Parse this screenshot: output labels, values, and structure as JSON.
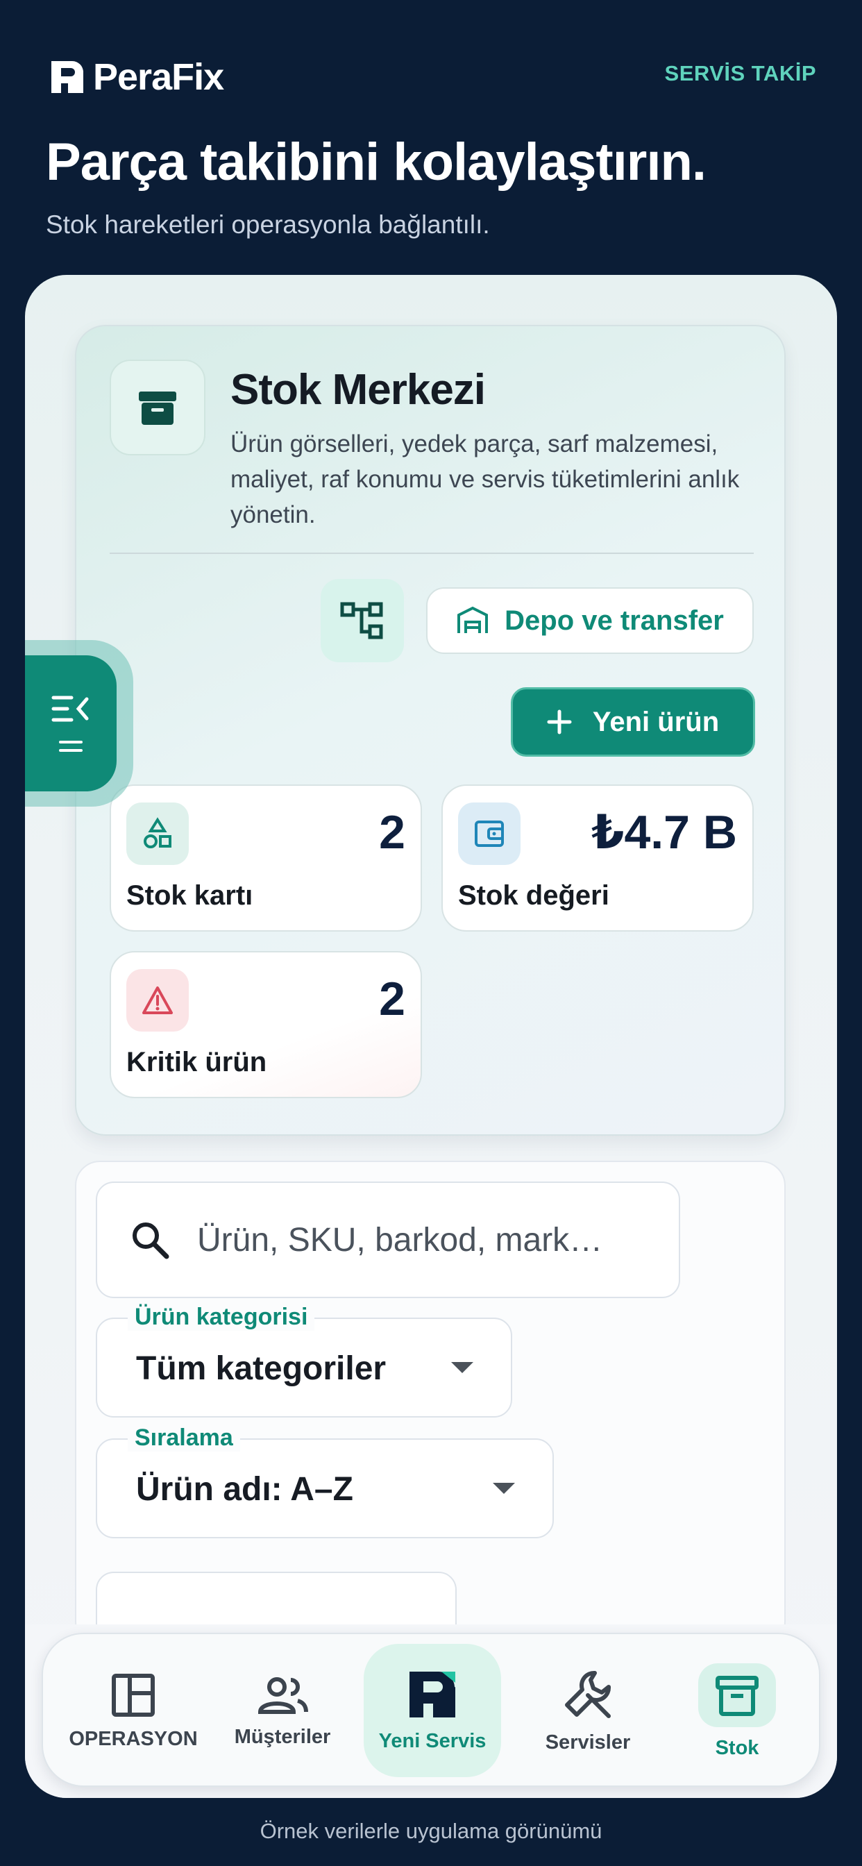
{
  "header": {
    "logo_text": "PeraFix",
    "servis_takip": "SERVİS TAKİP",
    "title": "Parça takibini kolaylaştırın.",
    "subtitle": "Stok hareketleri operasyonla bağlantılı."
  },
  "stock_card": {
    "icon": "archive-box-icon",
    "title": "Stok Merkezi",
    "description": "Ürün görselleri, yedek parça, sarf malzemesi, maliyet, raf konumu ve servis tüketimlerini anlık yönetin.",
    "hierarchy_icon": "hierarchy-icon",
    "warehouse_button": "Depo ve transfer",
    "new_product_button": "Yeni ürün",
    "stats": [
      {
        "value": "2",
        "label": "Stok kartı",
        "icon": "shapes-icon"
      },
      {
        "value": "₺4.7 B",
        "label": "Stok değeri",
        "icon": "wallet-icon"
      },
      {
        "value": "2",
        "label": "Kritik ürün",
        "icon": "warning-icon"
      }
    ]
  },
  "filters": {
    "search_placeholder": "Ürün, SKU, barkod, mark…",
    "category": {
      "label": "Ürün kategorisi",
      "value": "Tüm kategoriler"
    },
    "sort": {
      "label": "Sıralama",
      "value": "Ürün adı: A–Z"
    }
  },
  "bottom_nav": [
    {
      "label": "OPERASYON",
      "icon": "dashboard-icon"
    },
    {
      "label": "Müşteriler",
      "icon": "users-icon"
    },
    {
      "label": "Yeni Servis",
      "icon": "perafix-logo-icon"
    },
    {
      "label": "Servisler",
      "icon": "wrench-icon"
    },
    {
      "label": "Stok",
      "icon": "archive-box-icon"
    }
  ],
  "footer": "Örnek verilerle uygulama görünümü",
  "colors": {
    "background": "#0b1d36",
    "accent": "#0f8a77",
    "accent_light": "#5fd3bd",
    "critical": "#d9485a"
  }
}
